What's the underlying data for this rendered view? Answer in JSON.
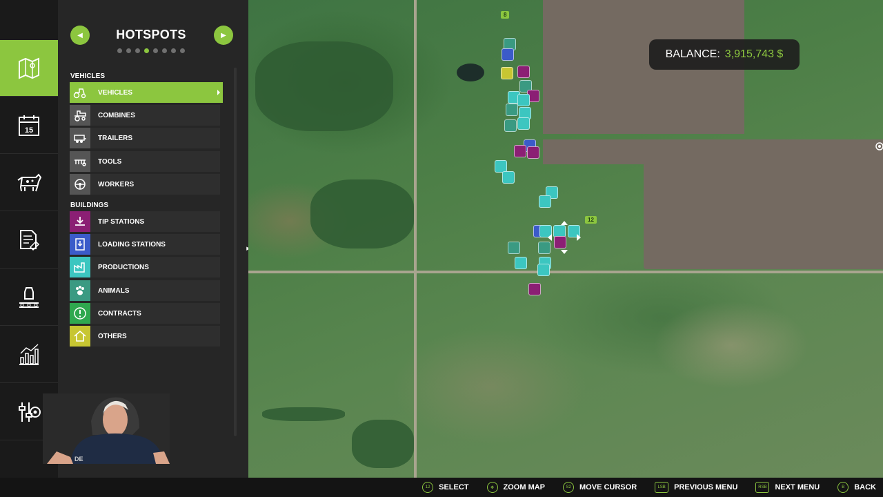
{
  "panel": {
    "title": "HOTSPOTS",
    "page_dots": 8,
    "active_page": 3,
    "sections": [
      {
        "label": "VEHICLES",
        "items": [
          {
            "label": "VEHICLES",
            "icon": "tractor-icon",
            "color": "#555555",
            "selected": true
          },
          {
            "label": "COMBINES",
            "icon": "combine-icon",
            "color": "#555555"
          },
          {
            "label": "TRAILERS",
            "icon": "trailer-icon",
            "color": "#555555"
          },
          {
            "label": "TOOLS",
            "icon": "tool-icon",
            "color": "#555555"
          },
          {
            "label": "WORKERS",
            "icon": "steering-wheel-icon",
            "color": "#555555"
          }
        ]
      },
      {
        "label": "BUILDINGS",
        "items": [
          {
            "label": "TIP STATIONS",
            "icon": "tip-station-icon",
            "color": "#8b1f74"
          },
          {
            "label": "LOADING STATIONS",
            "icon": "loading-station-icon",
            "color": "#3b5bc9"
          },
          {
            "label": "PRODUCTIONS",
            "icon": "factory-icon",
            "color": "#3cc6c0"
          },
          {
            "label": "ANIMALS",
            "icon": "paw-icon",
            "color": "#3a9a82"
          },
          {
            "label": "CONTRACTS",
            "icon": "exclamation-icon",
            "color": "#2fa84f"
          },
          {
            "label": "OTHERS",
            "icon": "house-icon",
            "color": "#c7c632"
          }
        ]
      }
    ]
  },
  "rail": [
    {
      "icon": "map-icon",
      "active": true
    },
    {
      "icon": "calendar-icon",
      "text": "15"
    },
    {
      "icon": "cow-icon"
    },
    {
      "icon": "contracts-icon"
    },
    {
      "icon": "production-icon"
    },
    {
      "icon": "statistics-icon"
    },
    {
      "icon": "settings-icon"
    }
  ],
  "webcam_label": "DE",
  "balance": {
    "label": "BALANCE:",
    "value": "3,915,743 $"
  },
  "map": {
    "field_numbers": [
      "8",
      "12"
    ]
  },
  "bottom_bar": [
    {
      "key": "12",
      "label": "SELECT"
    },
    {
      "key": "✥",
      "label": "ZOOM MAP"
    },
    {
      "key": "S2",
      "label": "MOVE CURSOR"
    },
    {
      "key": "LSB",
      "label": "PREVIOUS MENU",
      "rect": true
    },
    {
      "key": "RSB",
      "label": "NEXT MENU",
      "rect": true
    },
    {
      "key": "B",
      "label": "BACK"
    }
  ],
  "colors": {
    "accent": "#8cc63f",
    "panel": "#262626",
    "rail": "#1a1a1a"
  }
}
